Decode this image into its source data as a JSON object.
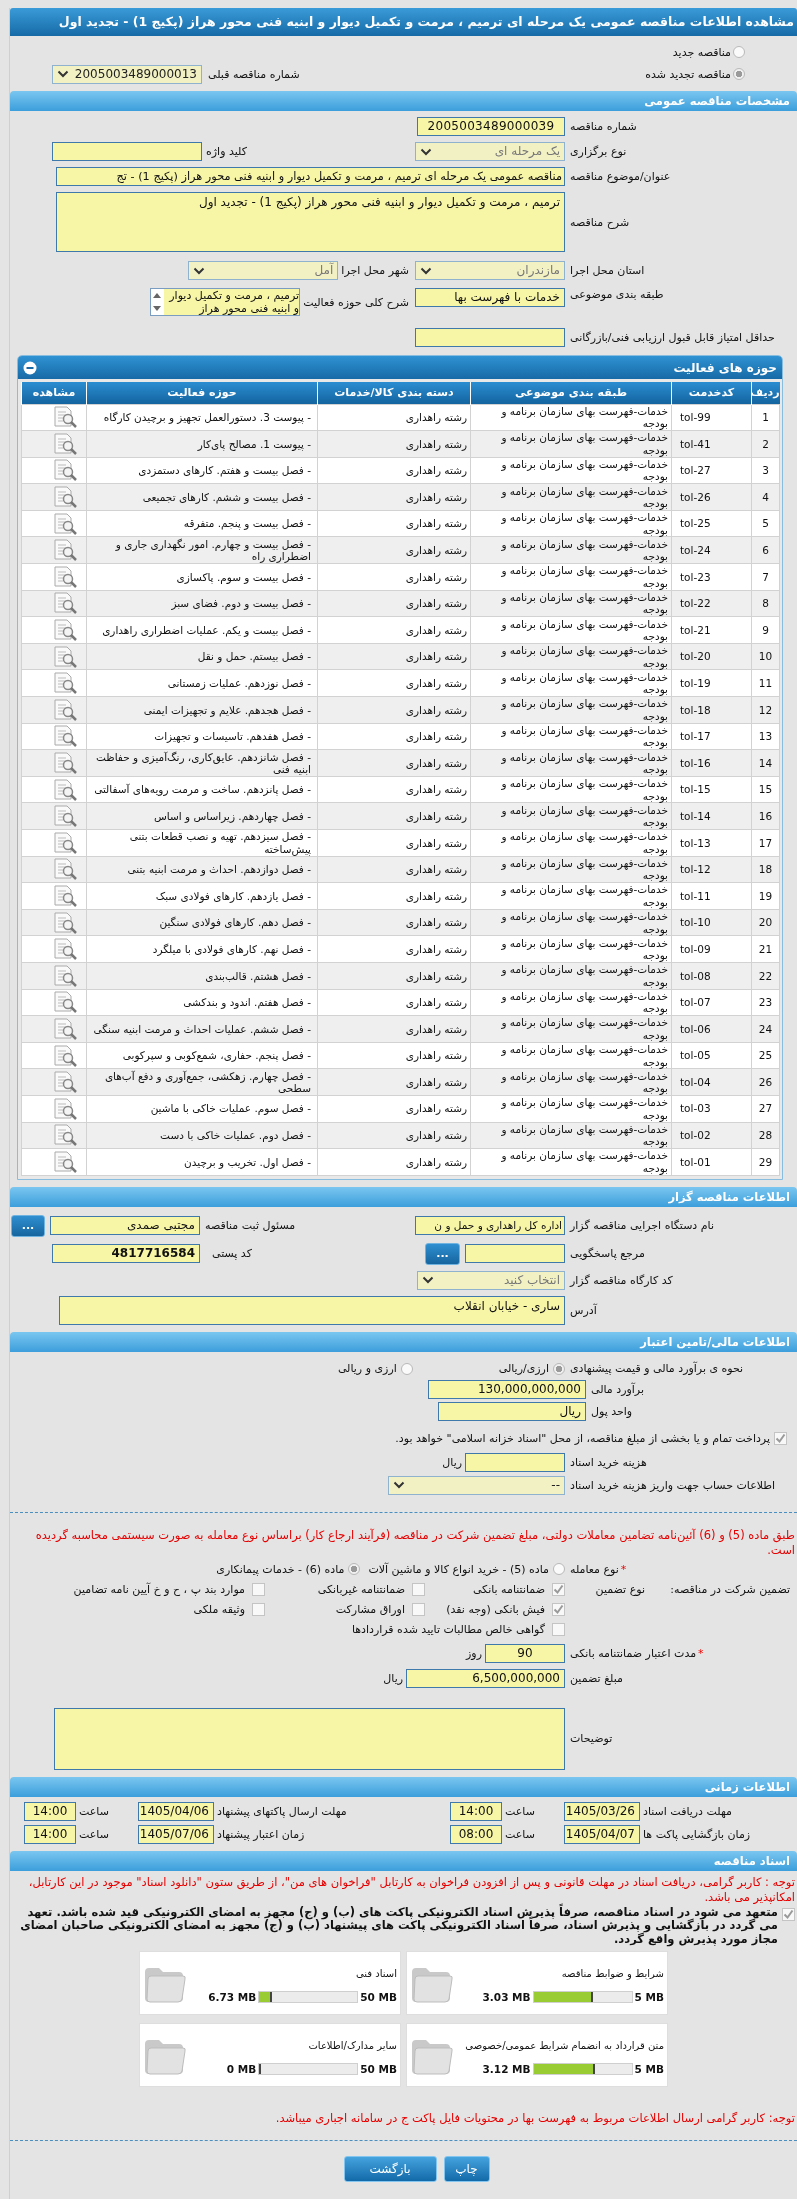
{
  "title": "مشاهده اطلاعات مناقصه عمومی یک مرحله ای ترمیم ، مرمت و تکمیل دیوار و ابنیه فنی محور هراز (پکیج 1) - تجدید اول",
  "tender_type": [
    {
      "label": "مناقصه جدید",
      "selected": false
    },
    {
      "label": "مناقصه تجدید شده",
      "selected": true
    }
  ],
  "previous_tender": {
    "label": "شماره مناقصه قبلی",
    "value": "2005003489000013"
  },
  "general": {
    "header": "مشخصات مناقصه عمومی",
    "tender_number": {
      "label": "شماره مناقصه",
      "value": "2005003489000039"
    },
    "holding_type": {
      "label": "نوع برگزاری",
      "value": "یک مرحله ای"
    },
    "keyword": {
      "label": "کلید واژه"
    },
    "subject": {
      "label": "عنوان/موضوع مناقصه",
      "value": "مناقصه عمومی یک مرحله ای ترمیم ، مرمت و تکمیل دیوار و ابنیه فنی محور هراز (پکیج 1) - تج"
    },
    "description": {
      "label": "شرح مناقصه",
      "value": "ترمیم ، مرمت و تکمیل دیوار و ابنیه فنی محور هراز (پکیج 1) - تجدید اول"
    },
    "province": {
      "label": "استان محل اجرا",
      "value": "مازندران"
    },
    "city": {
      "label": "شهر محل اجرا",
      "value": "آمل"
    },
    "classification": {
      "label": "طبقه بندی موضوعی",
      "value": "خدمات با فهرست بها"
    },
    "activity_scope": {
      "label": "شرح کلی حوزه فعالیت",
      "value": "ترمیم ، مرمت و تکمیل دیوار و ابنیه فنی محور هراز"
    },
    "min_score": {
      "label": "حداقل امتیاز قابل قبول ارزیابی فنی/بازرگانی"
    }
  },
  "activities": {
    "header": "حوزه های فعالیت",
    "columns": [
      "ردیف",
      "کدخدمت",
      "طبقه بندی موضوعی",
      "دسته بندی کالا/خدمات",
      "حوزه فعالیت",
      "مشاهده"
    ],
    "rows": [
      {
        "row": "1",
        "code": "tol-99",
        "category": "خدمات-فهرست بهای سازمان برنامه و بودجه",
        "group": "رشته راهداری",
        "activity": "- پیوست 3. دستورالعمل تجهیز و برچیدن کارگاه"
      },
      {
        "row": "2",
        "code": "tol-41",
        "category": "خدمات-فهرست بهای سازمان برنامه و بودجه",
        "group": "رشته راهداری",
        "activity": "- پیوست 1. مصالح پای‌کار"
      },
      {
        "row": "3",
        "code": "tol-27",
        "category": "خدمات-فهرست بهای سازمان برنامه و بودجه",
        "group": "رشته راهداری",
        "activity": "- فصل بیست و هفتم. کارهای دستمزدی"
      },
      {
        "row": "4",
        "code": "tol-26",
        "category": "خدمات-فهرست بهای سازمان برنامه و بودجه",
        "group": "رشته راهداری",
        "activity": "- فصل بیست و ششم. کارهای تجمیعی"
      },
      {
        "row": "5",
        "code": "tol-25",
        "category": "خدمات-فهرست بهای سازمان برنامه و بودجه",
        "group": "رشته راهداری",
        "activity": "- فصل بیست و پنجم. متفرقه"
      },
      {
        "row": "6",
        "code": "tol-24",
        "category": "خدمات-فهرست بهای سازمان برنامه و بودجه",
        "group": "رشته راهداری",
        "activity": "- فصل بیست و چهارم. امور نگهداری جاری و اضطراری راه"
      },
      {
        "row": "7",
        "code": "tol-23",
        "category": "خدمات-فهرست بهای سازمان برنامه و بودجه",
        "group": "رشته راهداری",
        "activity": "- فصل بیست و سوم. پاکسازی"
      },
      {
        "row": "8",
        "code": "tol-22",
        "category": "خدمات-فهرست بهای سازمان برنامه و بودجه",
        "group": "رشته راهداری",
        "activity": "- فصل بیست و دوم. فضای سبز"
      },
      {
        "row": "9",
        "code": "tol-21",
        "category": "خدمات-فهرست بهای سازمان برنامه و بودجه",
        "group": "رشته راهداری",
        "activity": "- فصل بیست و یکم. عملیات اضطراری راهداری"
      },
      {
        "row": "10",
        "code": "tol-20",
        "category": "خدمات-فهرست بهای سازمان برنامه و بودجه",
        "group": "رشته راهداری",
        "activity": "- فصل بیستم. حمل و نقل"
      },
      {
        "row": "11",
        "code": "tol-19",
        "category": "خدمات-فهرست بهای سازمان برنامه و بودجه",
        "group": "رشته راهداری",
        "activity": "- فصل نوزدهم. عملیات زمستانی"
      },
      {
        "row": "12",
        "code": "tol-18",
        "category": "خدمات-فهرست بهای سازمان برنامه و بودجه",
        "group": "رشته راهداری",
        "activity": "- فصل هجدهم. علایم و تجهیزات ایمنی"
      },
      {
        "row": "13",
        "code": "tol-17",
        "category": "خدمات-فهرست بهای سازمان برنامه و بودجه",
        "group": "رشته راهداری",
        "activity": "- فصل هفدهم. تاسیسات و تجهیزات"
      },
      {
        "row": "14",
        "code": "tol-16",
        "category": "خدمات-فهرست بهای سازمان برنامه و بودجه",
        "group": "رشته راهداری",
        "activity": "- فصل شانزدهم. عایق‌کاری، رنگ‌آمیزی و حفاظت ابنیه فنی"
      },
      {
        "row": "15",
        "code": "tol-15",
        "category": "خدمات-فهرست بهای سازمان برنامه و بودجه",
        "group": "رشته راهداری",
        "activity": "- فصل پانزدهم. ساخت و مرمت رویه‌های آسفالتی"
      },
      {
        "row": "16",
        "code": "tol-14",
        "category": "خدمات-فهرست بهای سازمان برنامه و بودجه",
        "group": "رشته راهداری",
        "activity": "- فصل چهاردهم. زیراساس و اساس"
      },
      {
        "row": "17",
        "code": "tol-13",
        "category": "خدمات-فهرست بهای سازمان برنامه و بودجه",
        "group": "رشته راهداری",
        "activity": "- فصل سیزدهم. تهیه و نصب قطعات بتنی پیش‌ساخته"
      },
      {
        "row": "18",
        "code": "tol-12",
        "category": "خدمات-فهرست بهای سازمان برنامه و بودجه",
        "group": "رشته راهداری",
        "activity": "- فصل دوازدهم. احداث و مرمت ابنیه بتنی"
      },
      {
        "row": "19",
        "code": "tol-11",
        "category": "خدمات-فهرست بهای سازمان برنامه و بودجه",
        "group": "رشته راهداری",
        "activity": "- فصل یازدهم. کارهای فولادی سبک"
      },
      {
        "row": "20",
        "code": "tol-10",
        "category": "خدمات-فهرست بهای سازمان برنامه و بودجه",
        "group": "رشته راهداری",
        "activity": "- فصل دهم. کارهای فولادی سنگین"
      },
      {
        "row": "21",
        "code": "tol-09",
        "category": "خدمات-فهرست بهای سازمان برنامه و بودجه",
        "group": "رشته راهداری",
        "activity": "- فصل نهم. کارهای فولادی با میلگرد"
      },
      {
        "row": "22",
        "code": "tol-08",
        "category": "خدمات-فهرست بهای سازمان برنامه و بودجه",
        "group": "رشته راهداری",
        "activity": "- فصل هشتم. قالب‌بندی"
      },
      {
        "row": "23",
        "code": "tol-07",
        "category": "خدمات-فهرست بهای سازمان برنامه و بودجه",
        "group": "رشته راهداری",
        "activity": "- فصل هفتم. اندود و بندکشی"
      },
      {
        "row": "24",
        "code": "tol-06",
        "category": "خدمات-فهرست بهای سازمان برنامه و بودجه",
        "group": "رشته راهداری",
        "activity": "- فصل ششم.  عملیات احداث و مرمت ابنیه سنگی"
      },
      {
        "row": "25",
        "code": "tol-05",
        "category": "خدمات-فهرست بهای سازمان برنامه و بودجه",
        "group": "رشته راهداری",
        "activity": "- فصل پنجم. حفاری، شمع‌کوبی و سپرکوبی"
      },
      {
        "row": "26",
        "code": "tol-04",
        "category": "خدمات-فهرست بهای سازمان برنامه و بودجه",
        "group": "رشته راهداری",
        "activity": "- فصل چهارم. زهکشی، جمع‌آوری و دفع آب‌های سطحی"
      },
      {
        "row": "27",
        "code": "tol-03",
        "category": "خدمات-فهرست بهای سازمان برنامه و بودجه",
        "group": "رشته راهداری",
        "activity": "- فصل سوم. عملیات خاکی با ماشین"
      },
      {
        "row": "28",
        "code": "tol-02",
        "category": "خدمات-فهرست بهای سازمان برنامه و بودجه",
        "group": "رشته راهداری",
        "activity": "- فصل دوم. عملیات خاکی با دست"
      },
      {
        "row": "29",
        "code": "tol-01",
        "category": "خدمات-فهرست بهای سازمان برنامه و بودجه",
        "group": "رشته راهداری",
        "activity": "- فصل اول. تخریب و برچیدن"
      }
    ]
  },
  "tenderer": {
    "header": "اطلاعات مناقصه گزار",
    "agency": {
      "label": "نام دستگاه اجرایی مناقصه گزار",
      "value": "اداره کل راهداری و حمل و ن"
    },
    "registrar": {
      "label": "مسئول ثبت مناقصه",
      "value": "مجتبی صمدی"
    },
    "registrar_button": "...",
    "response_ref": {
      "label": "مرجع پاسخگویی"
    },
    "response_button": "...",
    "postal_code": {
      "label": "کد پستی",
      "value": "4817716584"
    },
    "workshop_code": {
      "label": "کد کارگاه مناقصه گزار",
      "value": "انتخاب کنید"
    },
    "address": {
      "label": "آدرس",
      "value": "ساری - خیابان  انقلاب"
    }
  },
  "financial": {
    "header": "اطلاعات مالی/تامین اعتبار",
    "estimate_method": {
      "label": "نحوه ی برآورد مالی و قیمت پیشنهادی",
      "options": [
        {
          "label": "ارزی/ریالی",
          "selected": true
        },
        {
          "label": "ارزی و ریالی",
          "selected": false
        }
      ]
    },
    "estimate": {
      "label": "برآورد مالی",
      "value": "130,000,000,000"
    },
    "currency": {
      "label": "واحد پول",
      "value": "ریال"
    },
    "treasury": {
      "label": "پرداخت تمام و یا بخشی از مبلغ مناقصه، از محل \"اسناد خزانه اسلامی\" خواهد بود.",
      "checked": true
    },
    "doc_fee": {
      "label": "هزینه خرید اسناد",
      "unit": "ریال"
    },
    "account": {
      "label": "اطلاعات حساب جهت واریز هزینه خرید اسناد",
      "value": "--"
    },
    "notice": "طبق ماده (5) و (6) آئین‌نامه تضامین معاملات دولتی، مبلغ تضمین شرکت در مناقصه (فرآیند ارجاع کار) براساس نوع معامله به صورت سیستمی محاسبه گردیده است.",
    "deal_type": {
      "mark": "*",
      "label": "نوع معامله",
      "options": [
        {
          "label": "ماده (5) - خرید انواع کالا و ماشین آلات",
          "selected": false
        },
        {
          "label": "ماده (6) - خدمات پیمانکاری",
          "selected": true
        }
      ]
    },
    "guarantee": {
      "label": "تضمین شرکت در مناقصه:",
      "type_label": "نوع تضمین",
      "options": [
        {
          "label": "ضمانتنامه بانکی",
          "checked": true
        },
        {
          "label": "ضمانتنامه غیربانکی",
          "checked": false
        },
        {
          "label": "موارد بند پ ، ح و خ آیین نامه تضامین",
          "checked": false
        },
        {
          "label": "فیش بانکی (وجه نقد)",
          "checked": true
        },
        {
          "label": "اوراق مشارکت",
          "checked": false
        },
        {
          "label": "وثیقه ملکی",
          "checked": false
        },
        {
          "label": "گواهی خالص مطالبات تایید شده قراردادها",
          "checked": false
        }
      ]
    },
    "validity": {
      "mark": "*",
      "label": "مدت اعتبار ضمانتنامه بانکی",
      "value": "90",
      "unit": "روز"
    },
    "amount": {
      "label": "مبلغ تضمین",
      "value": "6,500,000,000",
      "unit": "ریال"
    },
    "notes": {
      "label": "توضیحات"
    }
  },
  "schedule": {
    "header": "اطلاعات زمانی",
    "items": [
      {
        "label": "مهلت دریافت اسناد",
        "date": "1405/03/26",
        "time_label": "ساعت",
        "time": "14:00"
      },
      {
        "label": "مهلت ارسال پاکتهای پیشنهاد",
        "date": "1405/04/06",
        "time_label": "ساعت",
        "time": "14:00"
      },
      {
        "label": "زمان بازگشایی پاکت ها",
        "date": "1405/04/07",
        "time_label": "ساعت",
        "time": "08:00"
      },
      {
        "label": "زمان اعتبار پیشنهاد",
        "date": "1405/07/06",
        "time_label": "ساعت",
        "time": "14:00"
      }
    ]
  },
  "documents": {
    "header": "اسناد مناقصه",
    "notice": "توجه : کاربر گرامی، دریافت اسناد در مهلت قانونی و پس از افزودن فراخوان به کارتابل \"فراخوان های من\"، از طریق ستون \"دانلود اسناد\" موجود در این کارتابل، امکانپذیر می باشد.",
    "commitment": {
      "label": "متعهد می شود در اسناد مناقصه، صرفاً پذیرش اسناد الکترونیکی پاکت های (ب) و (ج) مجهز به امضای الکترونیکی قید شده باشد. تعهد می گردد در بازگشایی و پذیرش اسناد، صرفاً اسناد الکترونیکی پاکت های پیشنهاد (ب) و (ج) مجهز به امضای الکترونیکی صاحبان امضای مجاز مورد پذیرش واقع گردد.",
      "checked": true
    },
    "files": [
      {
        "name": "شرایط و ضوابط مناقصه",
        "used": "3.03 MB",
        "limit": "5 MB",
        "level": 0.606
      },
      {
        "name": "اسناد فنی",
        "used": "6.73 MB",
        "limit": "50 MB",
        "level": 0.135
      },
      {
        "name": "متن قرارداد به انضمام شرایط عمومی/خصوصی",
        "used": "3.12 MB",
        "limit": "5 MB",
        "level": 0.624
      },
      {
        "name": "سایر مدارک/اطلاعات",
        "used": "0 MB",
        "limit": "50 MB",
        "level": 0
      }
    ],
    "note": "توجه: کاربر گرامی ارسال اطلاعات مربوط به فهرست بها در محتویات فایل پاکت ج در سامانه اجباری میباشد."
  },
  "buttons": [
    {
      "label": "چاپ"
    },
    {
      "label": "بازگشت"
    }
  ]
}
